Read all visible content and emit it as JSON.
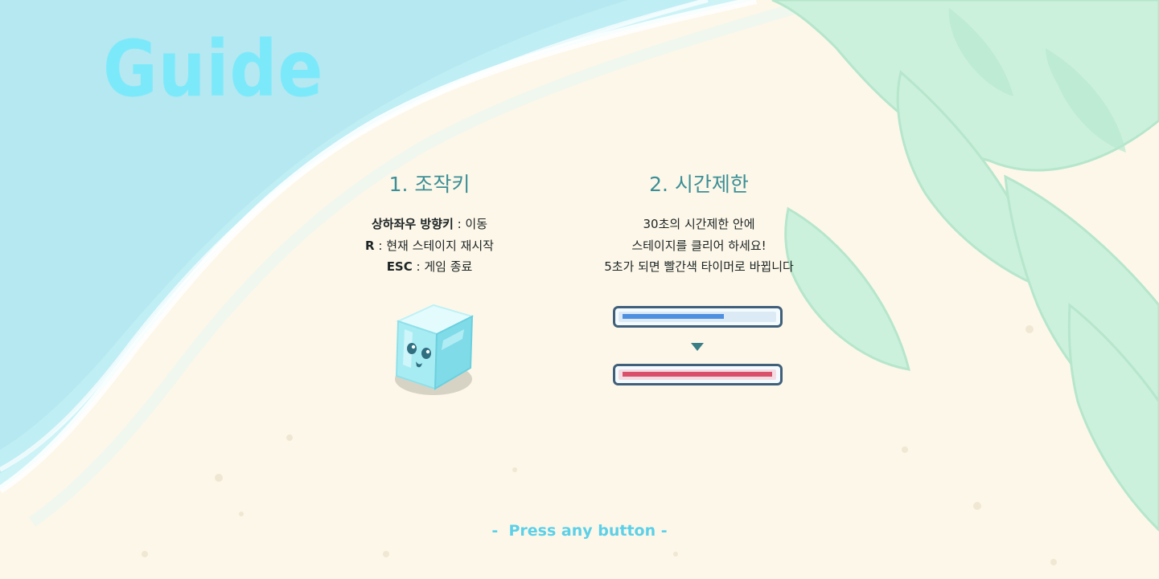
{
  "screen": {
    "title": "Guide",
    "press_prompt": "Press any button"
  },
  "controls": {
    "heading": "1. 조작키",
    "lines": [
      {
        "key": "상하좌우 방향키",
        "desc": " : 이동"
      },
      {
        "key": "R",
        "desc": " : 현재 스테이지 재시작"
      },
      {
        "key": "ESC",
        "desc": " : 게임 종료"
      }
    ]
  },
  "time_limit": {
    "heading": "2. 시간제한",
    "lines": [
      "30초의 시간제한 안에",
      "스테이지를 클리어 하세요!",
      "5초가 되면 빨간색 타이머로 바뀝니다"
    ],
    "normal_timer_fill": 0.68,
    "warning_timer_fill": 1.0
  },
  "colors": {
    "title": "#7ce9fb",
    "heading": "#3c8f96",
    "prompt": "#5cd0e8",
    "timer_normal": "#4f8fe0",
    "timer_warning": "#d9506a",
    "sea": "#c9f1f6",
    "sand": "#fdf7e9",
    "leaves": "#c6f0da"
  },
  "icons": [
    "ice-cube-character-icon",
    "down-arrow-icon",
    "timer-bar-normal",
    "timer-bar-warning"
  ]
}
